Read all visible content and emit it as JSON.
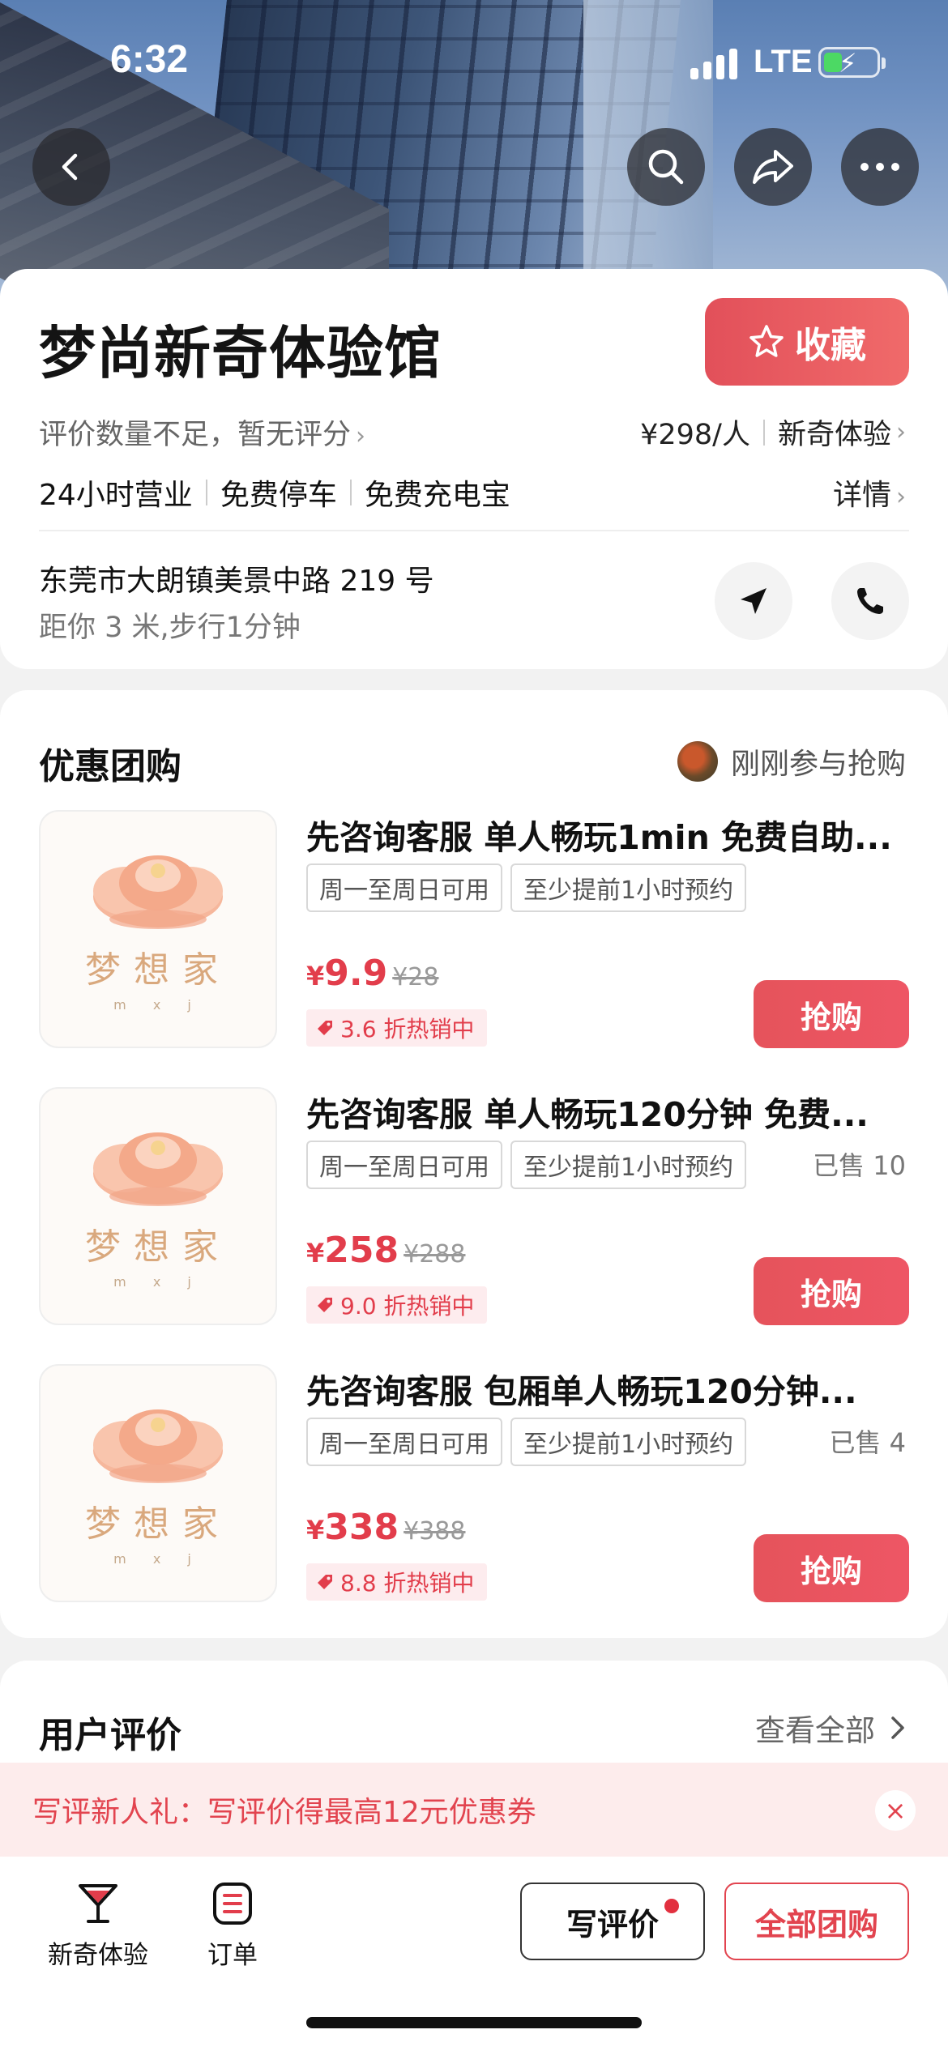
{
  "status_bar": {
    "time": "6:32",
    "network": "LTE"
  },
  "shop": {
    "name": "梦尚新奇体验馆",
    "favorite_label": "收藏",
    "rating_text": "评价数量不足，暂无评分",
    "price_per_person": "¥298/人",
    "category": "新奇体验",
    "features": [
      "24小时营业",
      "免费停车",
      "免费充电宝"
    ],
    "detail_label": "详情",
    "address": "东莞市大朗镇美景中路 219 号",
    "distance": "距你 3 米,步行1分钟"
  },
  "deals": {
    "title": "优惠团购",
    "recent_text": "刚刚参与抢购",
    "logo_text": "梦想家",
    "logo_sub": "m x j",
    "items": [
      {
        "title": "先咨询客服 单人畅玩1min 免费自助...",
        "chips": [
          "周一至周日可用",
          "至少提前1小时预约"
        ],
        "sold": "",
        "currency": "¥",
        "price": "9.9",
        "original_price": "¥28",
        "discount": "3.6 折热销中",
        "buy_label": "抢购"
      },
      {
        "title": "先咨询客服 单人畅玩120分钟 免费...",
        "chips": [
          "周一至周日可用",
          "至少提前1小时预约"
        ],
        "sold": "已售 10",
        "currency": "¥",
        "price": "258",
        "original_price": "¥288",
        "discount": "9.0 折热销中",
        "buy_label": "抢购"
      },
      {
        "title": "先咨询客服 包厢单人畅玩120分钟...",
        "chips": [
          "周一至周日可用",
          "至少提前1小时预约"
        ],
        "sold": "已售 4",
        "currency": "¥",
        "price": "338",
        "original_price": "¥388",
        "discount": "8.8 折热销中",
        "buy_label": "抢购"
      }
    ]
  },
  "reviews": {
    "title": "用户评价",
    "view_all": "查看全部"
  },
  "banner": {
    "text": "写评新人礼：写评价得最高12元优惠券",
    "close": "×"
  },
  "bottom_bar": {
    "tab_experience": "新奇体验",
    "tab_orders": "订单",
    "write_review": "写评价",
    "all_deals": "全部团购"
  },
  "colors": {
    "accent": "#e23d4b",
    "favorite_bg": "#ea5a60",
    "banner_bg": "#fdecec"
  }
}
